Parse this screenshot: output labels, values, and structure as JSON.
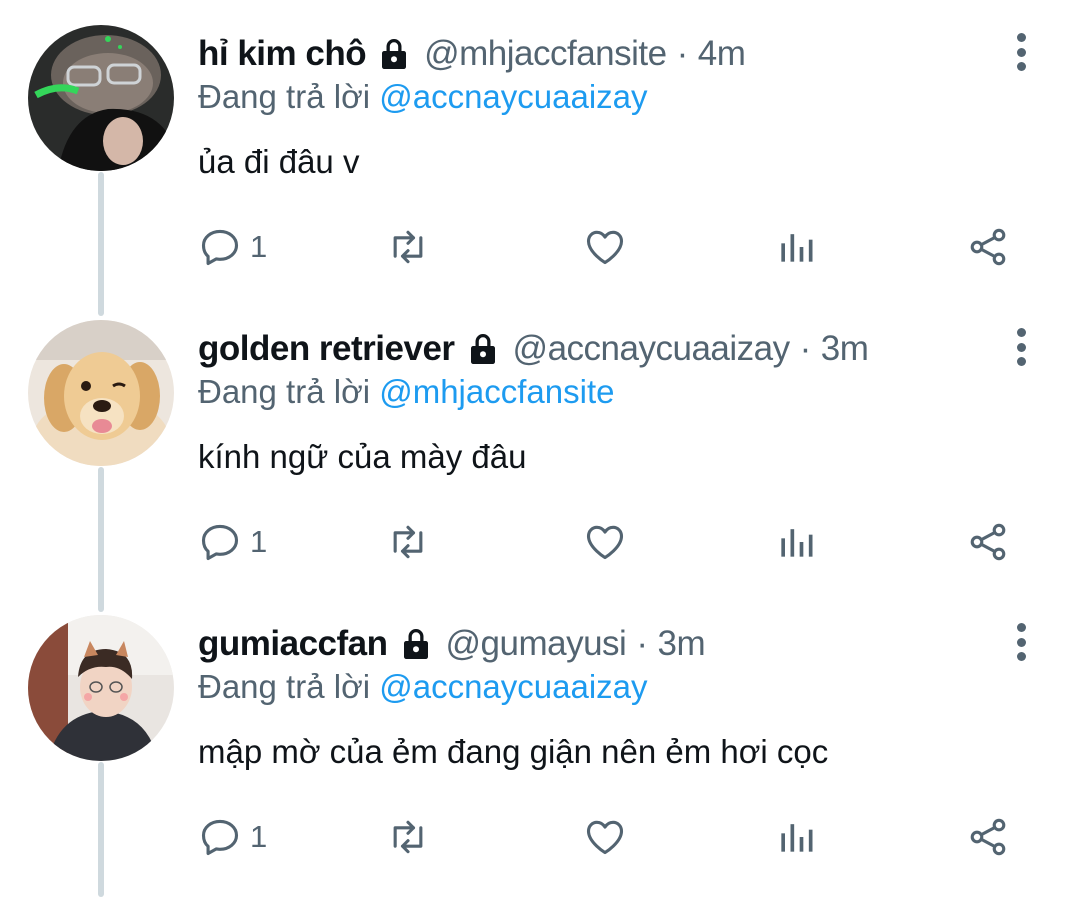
{
  "colors": {
    "text_primary": "#0f1419",
    "text_secondary": "#536471",
    "mention": "#1d9bf0",
    "thread_line": "#cfd9de",
    "icon": "#536471"
  },
  "reply_prefix": "Đang trả lời",
  "tweets": [
    {
      "display_name": "hỉ kim chô",
      "handle": "@mhjaccfansite",
      "dot": "·",
      "time": "4m",
      "reply_to": "@accnaycuaaizay",
      "text": "ủa đi đâu v",
      "reply_count": "1",
      "avatar_icon": "avatar-glasses-person-icon"
    },
    {
      "display_name": "golden retriever",
      "handle": "@accnaycuaaizay",
      "dot": "·",
      "time": "3m",
      "reply_to": "@mhjaccfansite",
      "text": "kính ngữ của mày đâu",
      "reply_count": "1",
      "avatar_icon": "avatar-golden-retriever-puppy-icon"
    },
    {
      "display_name": "gumiaccfan",
      "handle": "@gumayusi",
      "dot": "·",
      "time": "3m",
      "reply_to": "@accnaycuaaizay",
      "text": "mập mờ của ẻm đang giận nên ẻm hơi cọc",
      "reply_count": "1",
      "avatar_icon": "avatar-person-with-ears-filter-icon"
    }
  ]
}
